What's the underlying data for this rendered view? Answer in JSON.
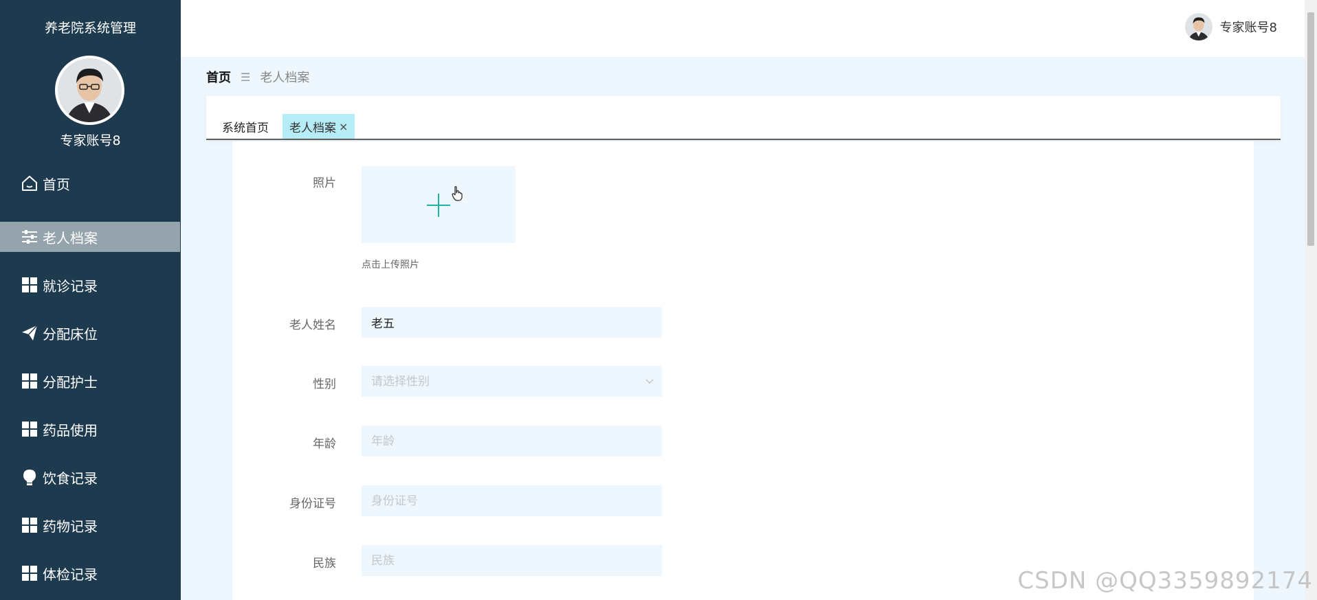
{
  "sidebar": {
    "system_title": "养老院系统管理",
    "user_name": "专家账号8",
    "items": [
      {
        "label": "首页",
        "icon": "home-icon"
      },
      {
        "label": "老人档案",
        "icon": "sliders-icon",
        "active": true
      },
      {
        "label": "就诊记录",
        "icon": "grid-icon"
      },
      {
        "label": "分配床位",
        "icon": "paper-plane-icon"
      },
      {
        "label": "分配护士",
        "icon": "grid-icon"
      },
      {
        "label": "药品使用",
        "icon": "grid-icon"
      },
      {
        "label": "饮食记录",
        "icon": "lightbulb-icon"
      },
      {
        "label": "药物记录",
        "icon": "grid-icon"
      },
      {
        "label": "体检记录",
        "icon": "grid-icon"
      }
    ]
  },
  "header": {
    "user_name": "专家账号8"
  },
  "breadcrumb": {
    "home": "首页",
    "separator": "☰",
    "current": "老人档案"
  },
  "tabs": [
    {
      "label": "系统首页"
    },
    {
      "label": "老人档案",
      "close": "×",
      "active": true
    }
  ],
  "form": {
    "photo": {
      "label": "照片",
      "hint": "点击上传照片"
    },
    "name": {
      "label": "老人姓名",
      "value": "老五"
    },
    "gender": {
      "label": "性别",
      "placeholder": "请选择性别"
    },
    "age": {
      "label": "年龄",
      "placeholder": "年龄"
    },
    "id_number": {
      "label": "身份证号",
      "placeholder": "身份证号"
    },
    "ethnicity": {
      "label": "民族",
      "placeholder": "民族"
    }
  },
  "watermark": "CSDN @QQ3359892174",
  "colors": {
    "sidebar_bg": "#1e3a4f",
    "sidebar_active": "#94a3ac",
    "main_bg": "#edf7fd",
    "tab_active": "#b6ecf6",
    "accent": "#1bb5a3"
  }
}
